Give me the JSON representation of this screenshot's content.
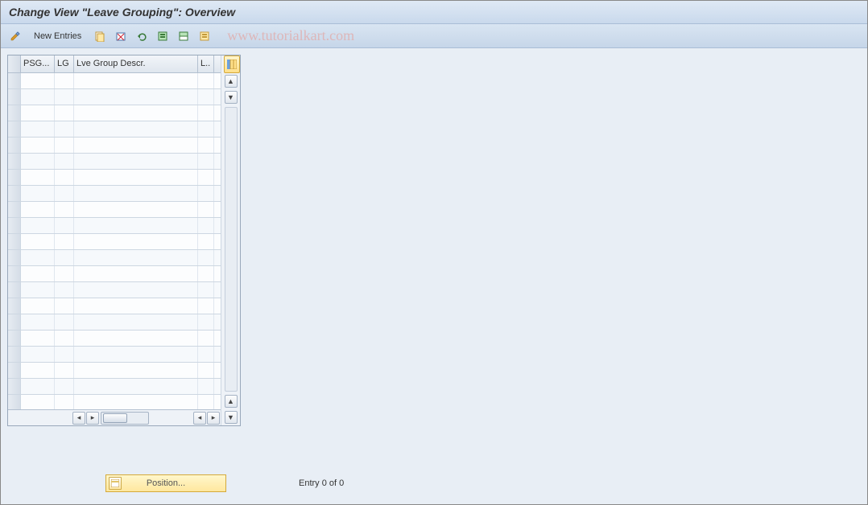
{
  "title": "Change View \"Leave Grouping\": Overview",
  "toolbar": {
    "new_entries_label": "New Entries"
  },
  "watermark": "www.tutorialkart.com",
  "table": {
    "columns": {
      "psg": "PSG...",
      "lg": "LG",
      "descr": "Lve Group Descr.",
      "l": "L.."
    },
    "row_count": 21
  },
  "position": {
    "button_label": "Position...",
    "entry_text": "Entry 0 of 0"
  },
  "icons": {
    "pencil": "pencil-icon",
    "copy": "copy-icon",
    "delete": "delete-icon",
    "undo": "undo-icon",
    "select_all": "select-all-icon",
    "select_block": "select-block-icon",
    "deselect": "deselect-icon",
    "config": "configure-columns-icon"
  }
}
